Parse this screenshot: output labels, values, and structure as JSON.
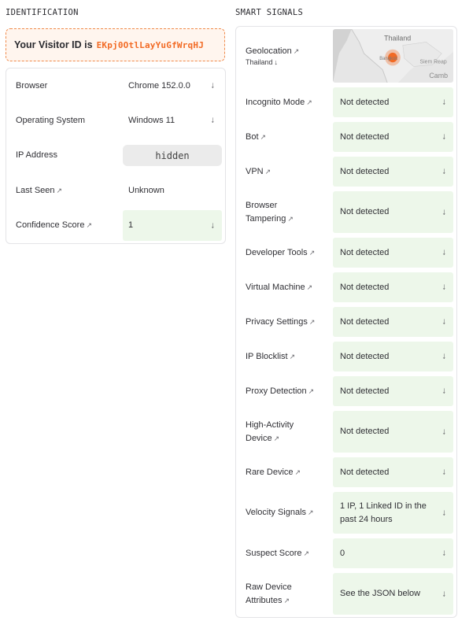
{
  "identification": {
    "title": "IDENTIFICATION",
    "visitor_prefix": "Your Visitor ID is",
    "visitor_id": "EKpj0OtlLayYuGfWrqHJ",
    "rows": [
      {
        "label": "Browser",
        "value": "Chrome 152.0.0",
        "link": false
      },
      {
        "label": "Operating System",
        "value": "Windows 11",
        "link": false
      },
      {
        "label": "IP Address",
        "value": "hidden",
        "link": false
      },
      {
        "label": "Last Seen",
        "value": "Unknown",
        "link": true
      },
      {
        "label": "Confidence Score",
        "value": "1",
        "link": true
      }
    ]
  },
  "smart_signals": {
    "title": "SMART SIGNALS",
    "geolocation": {
      "label": "Geolocation",
      "country": "Thailand",
      "map_labels": [
        "Thailand",
        "Bangkok",
        "Siem Reap",
        "Camb"
      ]
    },
    "rows": [
      {
        "label": "Incognito Mode",
        "value": "Not detected"
      },
      {
        "label": "Bot",
        "value": "Not detected"
      },
      {
        "label": "VPN",
        "value": "Not detected"
      },
      {
        "label": "Browser Tampering",
        "value": "Not detected"
      },
      {
        "label": "Developer Tools",
        "value": "Not detected"
      },
      {
        "label": "Virtual Machine",
        "value": "Not detected"
      },
      {
        "label": "Privacy Settings",
        "value": "Not detected"
      },
      {
        "label": "IP Blocklist",
        "value": "Not detected"
      },
      {
        "label": "Proxy Detection",
        "value": "Not detected"
      },
      {
        "label": "High-Activity Device",
        "value": "Not detected"
      },
      {
        "label": "Rare Device",
        "value": "Not detected"
      },
      {
        "label": "Velocity Signals",
        "value": "1 IP, 1 Linked ID in the past 24 hours"
      },
      {
        "label": "Suspect Score",
        "value": "0"
      },
      {
        "label": "Raw Device Attributes",
        "value": "See the JSON below"
      }
    ]
  },
  "icons": {
    "external_link": "↗",
    "expand": "↓"
  },
  "colors": {
    "accent": "#f26a24",
    "detected_bg": "#edf7ea",
    "border": "#e4e4e7"
  }
}
